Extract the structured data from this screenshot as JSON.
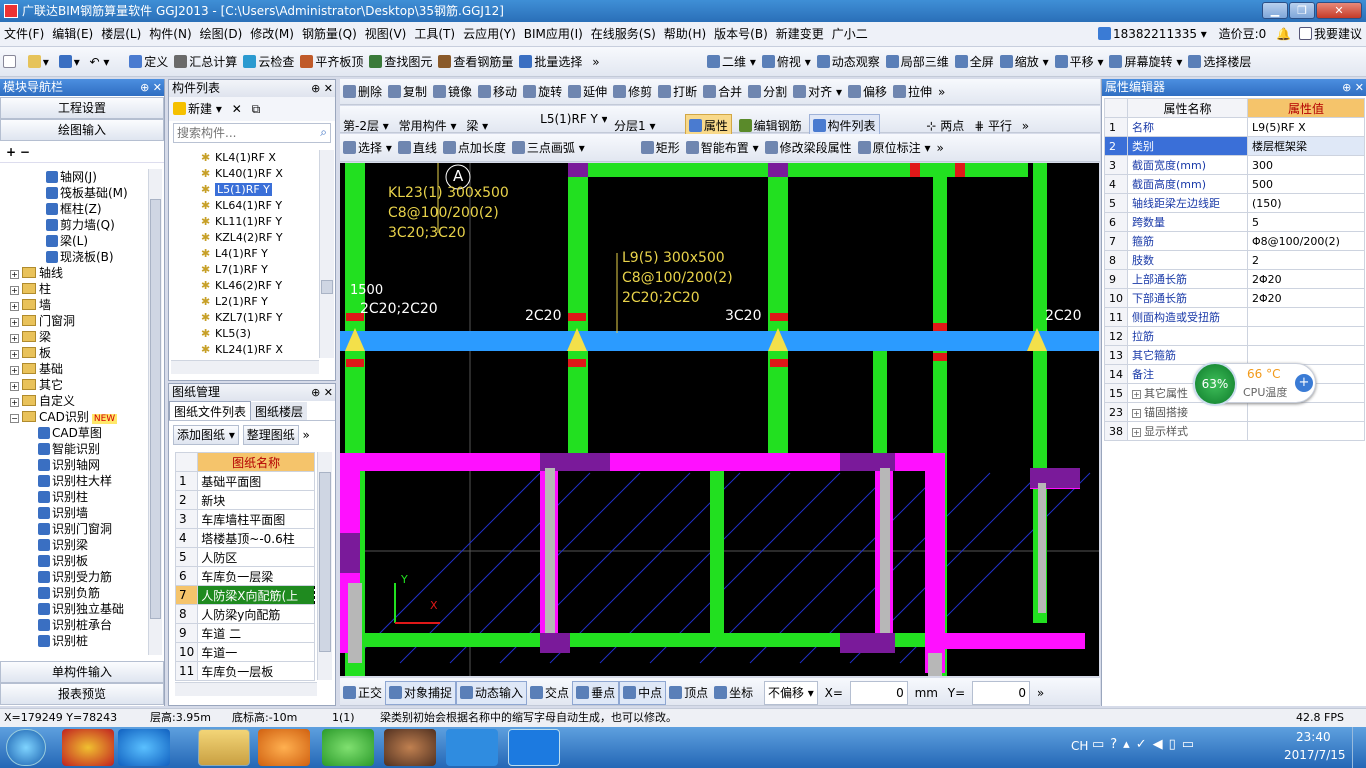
{
  "window": {
    "title": "广联达BIM钢筋算量软件 GGJ2013 - [C:\\Users\\Administrator\\Desktop\\35钢筋.GGJ12]"
  },
  "menu": [
    "文件(F)",
    "编辑(E)",
    "楼层(L)",
    "构件(N)",
    "绘图(D)",
    "修改(M)",
    "钢筋量(Q)",
    "视图(V)",
    "工具(T)",
    "云应用(Y)",
    "BIM应用(I)",
    "在线服务(S)",
    "帮助(H)",
    "版本号(B)",
    "新建变更",
    "广小二"
  ],
  "account": {
    "phone": "18382211335",
    "price_label": "造价豆:0",
    "suggest": "我要建议"
  },
  "toolbar1": [
    "定义",
    "汇总计算",
    "云检查",
    "平齐板顶",
    "查找图元",
    "查看钢筋量",
    "批量选择"
  ],
  "toolbar1_right": [
    "二维",
    "俯视",
    "动态观察",
    "局部三维",
    "全屏",
    "缩放",
    "平移",
    "屏幕旋转",
    "选择楼层"
  ],
  "toolbar2": [
    "删除",
    "复制",
    "镜像",
    "移动",
    "旋转",
    "延伸",
    "修剪",
    "打断",
    "合并",
    "分割",
    "对齐",
    "偏移",
    "拉伸"
  ],
  "toolbar3": {
    "floor": "第-2层",
    "category": "常用构件",
    "type": "梁",
    "component": "L5(1)RF Y",
    "layer": "分层1",
    "buttons": [
      "属性",
      "编辑钢筋",
      "构件列表",
      "两点",
      "平行"
    ]
  },
  "toolbar4": [
    "选择",
    "直线",
    "点加长度",
    "三点画弧",
    "矩形",
    "智能布置",
    "修改梁段属性",
    "原位标注"
  ],
  "nav": {
    "title": "模块导航栏",
    "project_settings": "工程设置",
    "drawing_input": "绘图输入",
    "tree": [
      {
        "label": "轴网(J)",
        "indent": 2
      },
      {
        "label": "筏板基础(M)",
        "indent": 2
      },
      {
        "label": "框柱(Z)",
        "indent": 2
      },
      {
        "label": "剪力墙(Q)",
        "indent": 2
      },
      {
        "label": "梁(L)",
        "indent": 2
      },
      {
        "label": "现浇板(B)",
        "indent": 2
      },
      {
        "label": "轴线",
        "indent": 0
      },
      {
        "label": "柱",
        "indent": 0
      },
      {
        "label": "墙",
        "indent": 0
      },
      {
        "label": "门窗洞",
        "indent": 0
      },
      {
        "label": "梁",
        "indent": 0
      },
      {
        "label": "板",
        "indent": 0
      },
      {
        "label": "基础",
        "indent": 0
      },
      {
        "label": "其它",
        "indent": 0
      },
      {
        "label": "自定义",
        "indent": 0
      },
      {
        "label": "CAD识别",
        "indent": 0,
        "badge": "NEW"
      },
      {
        "label": "CAD草图",
        "indent": 1
      },
      {
        "label": "智能识别",
        "indent": 1
      },
      {
        "label": "识别轴网",
        "indent": 1
      },
      {
        "label": "识别柱大样",
        "indent": 1
      },
      {
        "label": "识别柱",
        "indent": 1
      },
      {
        "label": "识别墙",
        "indent": 1
      },
      {
        "label": "识别门窗洞",
        "indent": 1
      },
      {
        "label": "识别梁",
        "indent": 1
      },
      {
        "label": "识别板",
        "indent": 1
      },
      {
        "label": "识别受力筋",
        "indent": 1
      },
      {
        "label": "识别负筋",
        "indent": 1
      },
      {
        "label": "识别独立基础",
        "indent": 1
      },
      {
        "label": "识别桩承台",
        "indent": 1
      },
      {
        "label": "识别桩",
        "indent": 1
      }
    ],
    "single_input": "单构件输入",
    "report": "报表预览"
  },
  "components": {
    "title": "构件列表",
    "new_label": "新建",
    "search_placeholder": "搜索构件...",
    "items": [
      "KL4(1)RF X",
      "KL40(1)RF X",
      "L5(1)RF Y",
      "KL64(1)RF Y",
      "KL11(1)RF Y",
      "KZL4(2)RF Y",
      "L4(1)RF Y",
      "L7(1)RF Y",
      "KL46(2)RF Y",
      "L2(1)RF Y",
      "KZL7(1)RF Y",
      "KL5(3)",
      "KL24(1)RF X"
    ],
    "selected_index": 2
  },
  "drawings": {
    "title": "图纸管理",
    "tabs": [
      "图纸文件列表",
      "图纸楼层"
    ],
    "add": "添加图纸",
    "organize": "整理图纸",
    "column": "图纸名称",
    "rows": [
      "基础平面图",
      "新块",
      "车库墙柱平面图",
      "塔楼基顶~-0.6柱",
      "人防区",
      "车库负一层梁",
      "人防梁X向配筋(上",
      "人防梁y向配筋",
      "车道 二",
      "车道一",
      "车库负一层板"
    ],
    "selected_index": 6
  },
  "canvas": {
    "label_a": "A",
    "beam1": [
      "KL23(1) 300x500",
      "C8@100/200(2)",
      "3C20;3C20"
    ],
    "beam2": [
      "L9(5) 300x500",
      "C8@100/200(2)",
      "2C20;2C20"
    ],
    "left_text": "2C20;2C20",
    "left_num": "1500",
    "tags": [
      "2C20",
      "3C20",
      "2C20"
    ],
    "axis_y": "Y",
    "axis_x": "X"
  },
  "snapbar": {
    "items": [
      "正交",
      "对象捕捉",
      "动态输入",
      "交点",
      "垂点",
      "中点",
      "顶点",
      "坐标"
    ],
    "offset": "不偏移",
    "x_label": "X=",
    "x": "0",
    "unit": "mm",
    "y_label": "Y=",
    "y": "0"
  },
  "props": {
    "title": "属性编辑器",
    "col_name": "属性名称",
    "col_value": "属性值",
    "rows": [
      {
        "n": "1",
        "k": "名称",
        "v": "L9(5)RF X"
      },
      {
        "n": "2",
        "k": "类别",
        "v": "楼层框架梁"
      },
      {
        "n": "3",
        "k": "截面宽度(mm)",
        "v": "300"
      },
      {
        "n": "4",
        "k": "截面高度(mm)",
        "v": "500"
      },
      {
        "n": "5",
        "k": "轴线距梁左边线距",
        "v": "(150)"
      },
      {
        "n": "6",
        "k": "跨数量",
        "v": "5"
      },
      {
        "n": "7",
        "k": "箍筋",
        "v": "Φ8@100/200(2)"
      },
      {
        "n": "8",
        "k": "肢数",
        "v": "2"
      },
      {
        "n": "9",
        "k": "上部通长筋",
        "v": "2Φ20"
      },
      {
        "n": "10",
        "k": "下部通长筋",
        "v": "2Φ20"
      },
      {
        "n": "11",
        "k": "侧面构造或受扭筋",
        "v": ""
      },
      {
        "n": "12",
        "k": "拉筋",
        "v": ""
      },
      {
        "n": "13",
        "k": "其它箍筋",
        "v": ""
      },
      {
        "n": "14",
        "k": "备注",
        "v": ""
      },
      {
        "n": "15",
        "k": "其它属性",
        "v": "",
        "group": true
      },
      {
        "n": "23",
        "k": "锚固搭接",
        "v": "",
        "group": true
      },
      {
        "n": "38",
        "k": "显示样式",
        "v": "",
        "group": true
      }
    ]
  },
  "cpu": {
    "percent": "63%",
    "temp": "66 °C",
    "label": "CPU温度"
  },
  "status": {
    "coords": "X=179249 Y=78243",
    "floor_h": "层高:3.95m",
    "bottom_h": "底标高:-10m",
    "count": "1(1)",
    "hint": "梁类别初始会根据名称中的缩写字母自动生成，也可以修改。",
    "fps": "42.8 FPS"
  },
  "taskbar": {
    "lang": "CH",
    "time": "23:40",
    "date": "2017/7/15"
  },
  "colors": {
    "green": "#22e020",
    "magenta": "#ff10ff",
    "blue": "#2b9bff",
    "yellow": "#e8d24a",
    "purple": "#7a1a9a"
  }
}
